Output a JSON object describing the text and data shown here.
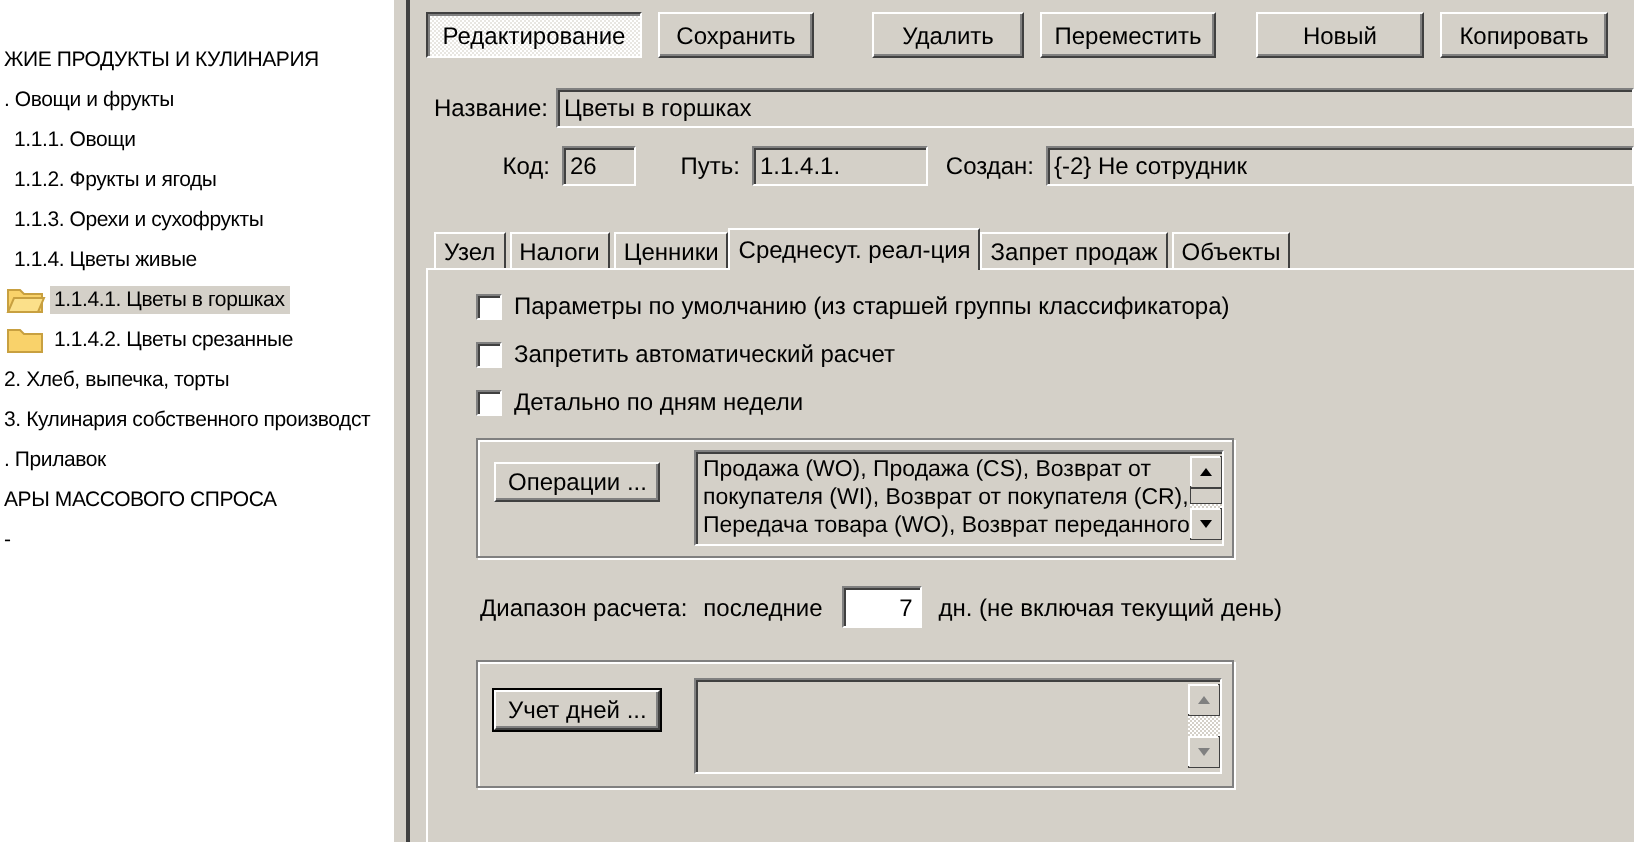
{
  "tree": [
    {
      "label": "ЖИЕ ПРОДУКТЫ И КУЛИНАРИЯ",
      "selected": false,
      "children": [
        {
          "label": ". Овощи и фрукты",
          "selected": false,
          "children": [
            {
              "label": "1.1.1. Овощи",
              "selected": false
            },
            {
              "label": "1.1.2. Фрукты и ягоды",
              "selected": false
            },
            {
              "label": "1.1.3. Орехи и сухофрукты",
              "selected": false
            },
            {
              "label": "1.1.4. Цветы живые",
              "selected": false,
              "children": [
                {
                  "label": "1.1.4.1. Цветы в горшках",
                  "selected": true,
                  "kind": "folder"
                },
                {
                  "label": "1.1.4.2. Цветы срезанные",
                  "selected": false,
                  "kind": "folder"
                }
              ]
            }
          ]
        },
        {
          "label": "2. Хлеб, выпечка, торты",
          "selected": false
        },
        {
          "label": "3. Кулинария собственного производст",
          "selected": false
        },
        {
          "label": ". Прилавок",
          "selected": false
        }
      ]
    },
    {
      "label": "АРЫ МАССОВОГО СПРОСА",
      "selected": false
    },
    {
      "label": "-",
      "selected": false
    }
  ],
  "toolbar": [
    {
      "label": "Редактирование",
      "selected": true
    },
    {
      "label": "Сохранить",
      "selected": false
    },
    {
      "label": "Удалить",
      "selected": false
    },
    {
      "label": "Переместить",
      "selected": false
    },
    {
      "label": "Новый",
      "selected": false
    },
    {
      "label": "Копировать",
      "selected": false
    }
  ],
  "name": {
    "label": "Название:",
    "value": "Цветы в горшках"
  },
  "info": [
    {
      "label": "Код:",
      "value": "26"
    },
    {
      "label": "Путь:",
      "value": "1.1.4.1."
    },
    {
      "label": "Создан:",
      "value": "{-2} Не сотрудник"
    }
  ],
  "tabs": [
    {
      "label": "Узел",
      "selected": false
    },
    {
      "label": "Налоги",
      "selected": false
    },
    {
      "label": "Ценники",
      "selected": false
    },
    {
      "label": "Среднесут. реал-ция",
      "selected": true
    },
    {
      "label": "Запрет продаж",
      "selected": false
    },
    {
      "label": "Объекты",
      "selected": false
    }
  ],
  "checkboxes": [
    {
      "label": "Параметры по умолчанию (из старшей группы классификатора)",
      "checked": false
    },
    {
      "label": "Запретить автоматический расчет",
      "checked": false
    },
    {
      "label": "Детально по дням недели",
      "checked": false
    }
  ],
  "operations": {
    "button": "Операции ...",
    "lines": [
      "Продажа (WO), Продажа (CS), Возврат от",
      "покупателя (WI), Возврат от покупателя (CR),",
      "Передача товара (WO), Возврат переданного"
    ],
    "disabled": false
  },
  "range": {
    "label": "Диапазон расчета:",
    "prefix": "последние",
    "value": "7",
    "suffix": "дн. (не включая текущий день)"
  },
  "days": {
    "button": "Учет дней ...",
    "disabled": true
  }
}
